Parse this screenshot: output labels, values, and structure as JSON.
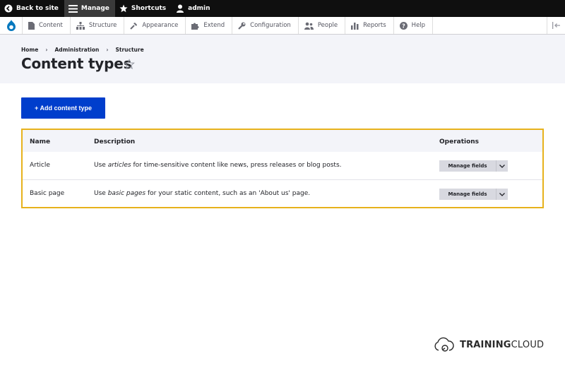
{
  "toolbar": {
    "back": "Back to site",
    "manage": "Manage",
    "shortcuts": "Shortcuts",
    "user": "admin"
  },
  "tray": {
    "items": [
      "Content",
      "Structure",
      "Appearance",
      "Extend",
      "Configuration",
      "People",
      "Reports",
      "Help"
    ]
  },
  "breadcrumb": [
    "Home",
    "Administration",
    "Structure"
  ],
  "page_title": "Content types",
  "add_button": "+ Add content type",
  "table": {
    "headers": [
      "Name",
      "Description",
      "Operations"
    ],
    "rows": [
      {
        "name": "Article",
        "desc_before": "Use ",
        "desc_em": "articles",
        "desc_after": " for time-sensitive content like news, press releases or blog posts.",
        "operation": "Manage fields"
      },
      {
        "name": "Basic page",
        "desc_before": "Use ",
        "desc_em": "basic pages",
        "desc_after": " for your static content, such as an 'About us' page.",
        "operation": "Manage fields"
      }
    ]
  },
  "watermark": {
    "bold": "TRAINING",
    "regular": "CLOUD"
  },
  "colors": {
    "primary_button": "#003ecc",
    "highlight_frame": "#e7b21c",
    "toolbar_bg": "#0f0f0f"
  }
}
